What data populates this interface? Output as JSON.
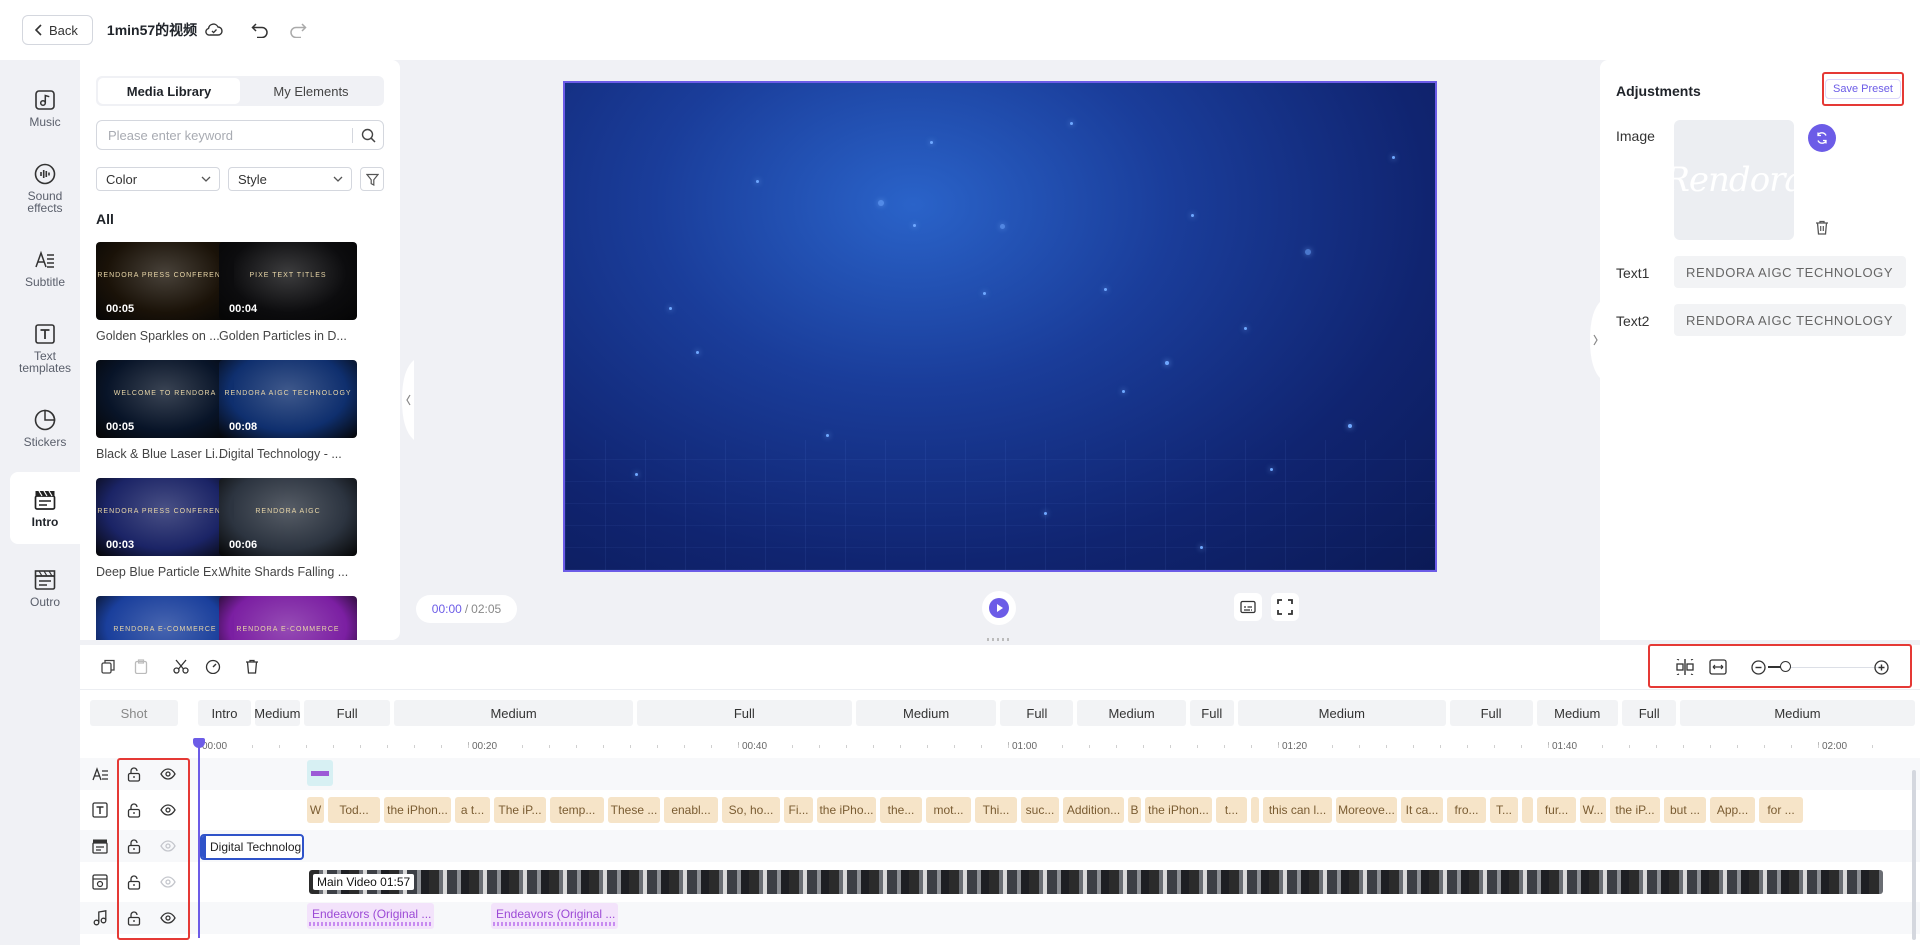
{
  "topbar": {
    "back_label": "Back",
    "project_title": "1min57的视频"
  },
  "sidebar": {
    "items": [
      {
        "label": "Music",
        "icon": "music-note-icon",
        "active": false
      },
      {
        "label": "Sound effects",
        "icon": "sound-wave-icon",
        "active": false
      },
      {
        "label": "Subtitle",
        "icon": "subtitle-icon",
        "active": false
      },
      {
        "label": "Text templates",
        "icon": "text-template-icon",
        "active": false
      },
      {
        "label": "Stickers",
        "icon": "sticker-icon",
        "active": false
      },
      {
        "label": "Intro",
        "icon": "intro-clapper-icon",
        "active": true
      },
      {
        "label": "Outro",
        "icon": "outro-clapper-icon",
        "active": false
      }
    ]
  },
  "media": {
    "tabs": [
      "Media Library",
      "My Elements"
    ],
    "active_tab": 0,
    "search_placeholder": "Please enter keyword",
    "filter_color": "Color",
    "filter_style": "Style",
    "section_label": "All",
    "cards": [
      {
        "title": "Golden Sparkles on ...",
        "duration": "00:05",
        "thumb_text": "RENDORA PRESS CONFERENCE",
        "bg": "#1a1208"
      },
      {
        "title": "Golden Particles in D...",
        "duration": "00:04",
        "thumb_text": "PIXE TEXT TITLES",
        "bg": "#0c0c0e"
      },
      {
        "title": "Black & Blue Laser Li...",
        "duration": "00:05",
        "thumb_text": "WELCOME TO RENDORA",
        "bg": "#081428"
      },
      {
        "title": "Digital Technology - ...",
        "duration": "00:08",
        "thumb_text": "RENDORA AIGC TECHNOLOGY",
        "bg": "#0f2f6e"
      },
      {
        "title": "Deep Blue Particle Ex...",
        "duration": "00:03",
        "thumb_text": "RENDORA PRESS CONFERENCE",
        "bg": "#1b2466"
      },
      {
        "title": "White Shards Falling ...",
        "duration": "00:06",
        "thumb_text": "RENDORA AIGC",
        "bg": "#2c3440"
      },
      {
        "title": "",
        "duration": "",
        "thumb_text": "RENDORA E-COMMERCE",
        "bg": "#1a3f9c"
      },
      {
        "title": "",
        "duration": "",
        "thumb_text": "RENDORA E-COMMERCE",
        "bg": "#7b1fa2"
      }
    ]
  },
  "preview": {
    "time_current": "00:00",
    "time_total": "02:05"
  },
  "adjustments": {
    "title": "Adjustments",
    "save_preset": "Save Preset",
    "image_label": "Image",
    "image_logo": "Rendora",
    "text1_label": "Text1",
    "text1_value": "RENDORA  AIGC  TECHNOLOGY",
    "text2_label": "Text2",
    "text2_value": "RENDORA  AIGC  TECHNOLOGY"
  },
  "timeline": {
    "shot_label": "Shot",
    "shots": [
      {
        "label": "Intro",
        "start": 0,
        "end": 0.196
      },
      {
        "label": "Medium",
        "start": 0.196,
        "end": 0.365
      },
      {
        "label": "Full",
        "start": 0.365,
        "end": 0.677
      },
      {
        "label": "Medium",
        "start": 0.677,
        "end": 1.512
      },
      {
        "label": "Full",
        "start": 1.512,
        "end": 2.268
      },
      {
        "label": "Medium",
        "start": 2.268,
        "end": 2.766
      },
      {
        "label": "Full",
        "start": 2.766,
        "end": 3.032
      },
      {
        "label": "Medium",
        "start": 3.032,
        "end": 3.419
      },
      {
        "label": "Full",
        "start": 3.419,
        "end": 3.585
      },
      {
        "label": "Medium",
        "start": 3.585,
        "end": 4.315
      },
      {
        "label": "Full",
        "start": 4.315,
        "end": 4.615
      },
      {
        "label": "Medium",
        "start": 4.615,
        "end": 4.909
      },
      {
        "label": "Full",
        "start": 4.909,
        "end": 5.111
      },
      {
        "label": "Medium",
        "start": 5.111,
        "end": 5.931
      }
    ],
    "ruler": [
      {
        "label": "00:00",
        "seconds": 0
      },
      {
        "label": "00:20",
        "seconds": 20
      },
      {
        "label": "00:40",
        "seconds": 40
      },
      {
        "label": "01:00",
        "seconds": 60
      },
      {
        "label": "01:20",
        "seconds": 80
      },
      {
        "label": "01:40",
        "seconds": 100
      },
      {
        "label": "02:00",
        "seconds": 120
      }
    ],
    "text_segments": [
      "W",
      "Tod...",
      "the iPhon...",
      "a t...",
      "The iP...",
      "temp...",
      "These ...",
      "enabl...",
      "So, ho...",
      "Fi...",
      "the iPho...",
      "the...",
      "mot...",
      "Thi...",
      "suc...",
      "Addition...",
      "B",
      "the iPhon...",
      "t...",
      "",
      "this can l...",
      "Moreove...",
      "It ca...",
      "fro...",
      "T...",
      "",
      "fur...",
      "W...",
      "the iP...",
      "but ...",
      "App...",
      "for ..."
    ],
    "intro_clip": "Digital Technolog",
    "main_video": "Main Video 01:57",
    "audio_clips": [
      "Endeavors (Original ...",
      "Endeavors (Original ..."
    ]
  },
  "colors": {
    "accent": "#6c5ce7",
    "highlight": "#e53935",
    "segment": "#f6e4c8",
    "audio": "#f3e3fb"
  }
}
